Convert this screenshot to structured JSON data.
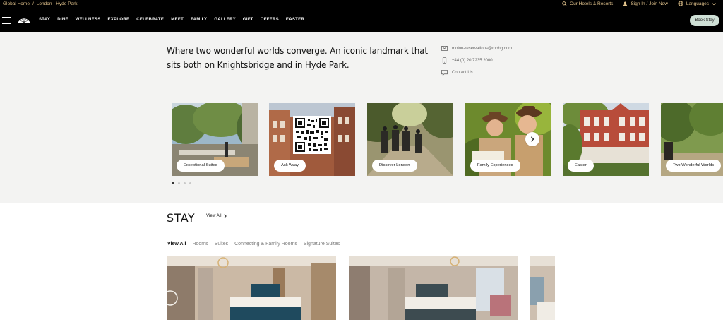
{
  "utility_bar": {
    "breadcrumb": [
      "Global Home",
      "/",
      "London - Hyde Park"
    ],
    "our_hotels": "Our Hotels & Resorts",
    "sign_in": "Sign In / Join Now",
    "languages": "Languages",
    "accent_color": "#e3c48d"
  },
  "nav": {
    "menu": [
      "STAY",
      "DINE",
      "WELLNESS",
      "EXPLORE",
      "CELEBRATE",
      "MEET",
      "FAMILY",
      "GALLERY",
      "GIFT",
      "OFFERS",
      "EASTER"
    ],
    "book_label": "Book Stay",
    "book_color": "#cfe0d6"
  },
  "intro": {
    "lead": "Where two wonderful worlds converge. An iconic landmark that sits both on Knightsbridge and in Hyde Park.",
    "email": "molon-reservations@mohg.com",
    "phone": "+44 (0) 20 7235 2000",
    "contact": "Contact Us"
  },
  "carousel": {
    "cards": [
      "Exceptional Suites",
      "Ask Away",
      "Discover London",
      "Family Experiences",
      "Easter",
      "Two Wonderful Worlds"
    ],
    "active_dot": 1,
    "dot_count": 4
  },
  "stay": {
    "title": "STAY",
    "view_all": "View All",
    "tabs": [
      "View All",
      "Rooms",
      "Suites",
      "Connecting & Family Rooms",
      "Signature Suites"
    ],
    "active_tab": "View All"
  }
}
